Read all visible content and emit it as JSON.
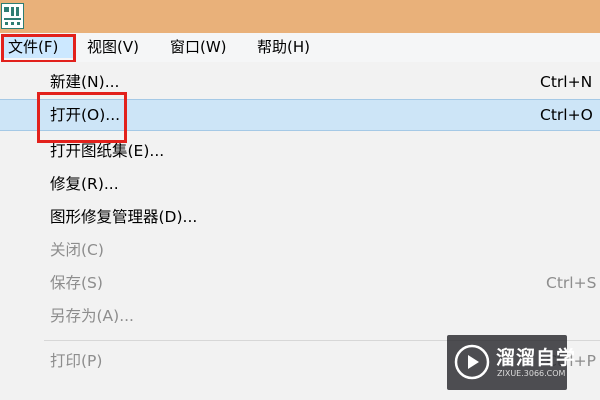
{
  "menubar": {
    "items": [
      {
        "label": "文件(F)",
        "active": true
      },
      {
        "label": "视图(V)"
      },
      {
        "label": "窗口(W)"
      },
      {
        "label": "帮助(H)"
      }
    ]
  },
  "file_menu": {
    "items": [
      {
        "label": "新建(N)...",
        "shortcut": "Ctrl+N"
      },
      {
        "label": "打开(O)...",
        "shortcut": "Ctrl+O",
        "selected": true
      },
      {
        "label": "打开图纸集(E)..."
      },
      {
        "label": "修复(R)..."
      },
      {
        "label": "图形修复管理器(D)..."
      },
      {
        "label": "关闭(C)",
        "disabled": true
      },
      {
        "label": "保存(S)",
        "shortcut": "Ctrl+S",
        "disabled": true
      },
      {
        "label": "另存为(A)...",
        "disabled": true
      },
      {
        "label": "打印(P)",
        "shortcut": "Ctrl+P",
        "disabled": true
      }
    ]
  },
  "watermark": {
    "title": "溜溜自学",
    "subtitle": "ZIXUE.3066.COM"
  },
  "colors": {
    "titlebar": "#e9b17a",
    "selection": "#cde5f7",
    "highlight_box": "#e2211c",
    "disabled_text": "#8d8d8d"
  },
  "icons": [
    "app-logo-icon",
    "play-icon"
  ]
}
